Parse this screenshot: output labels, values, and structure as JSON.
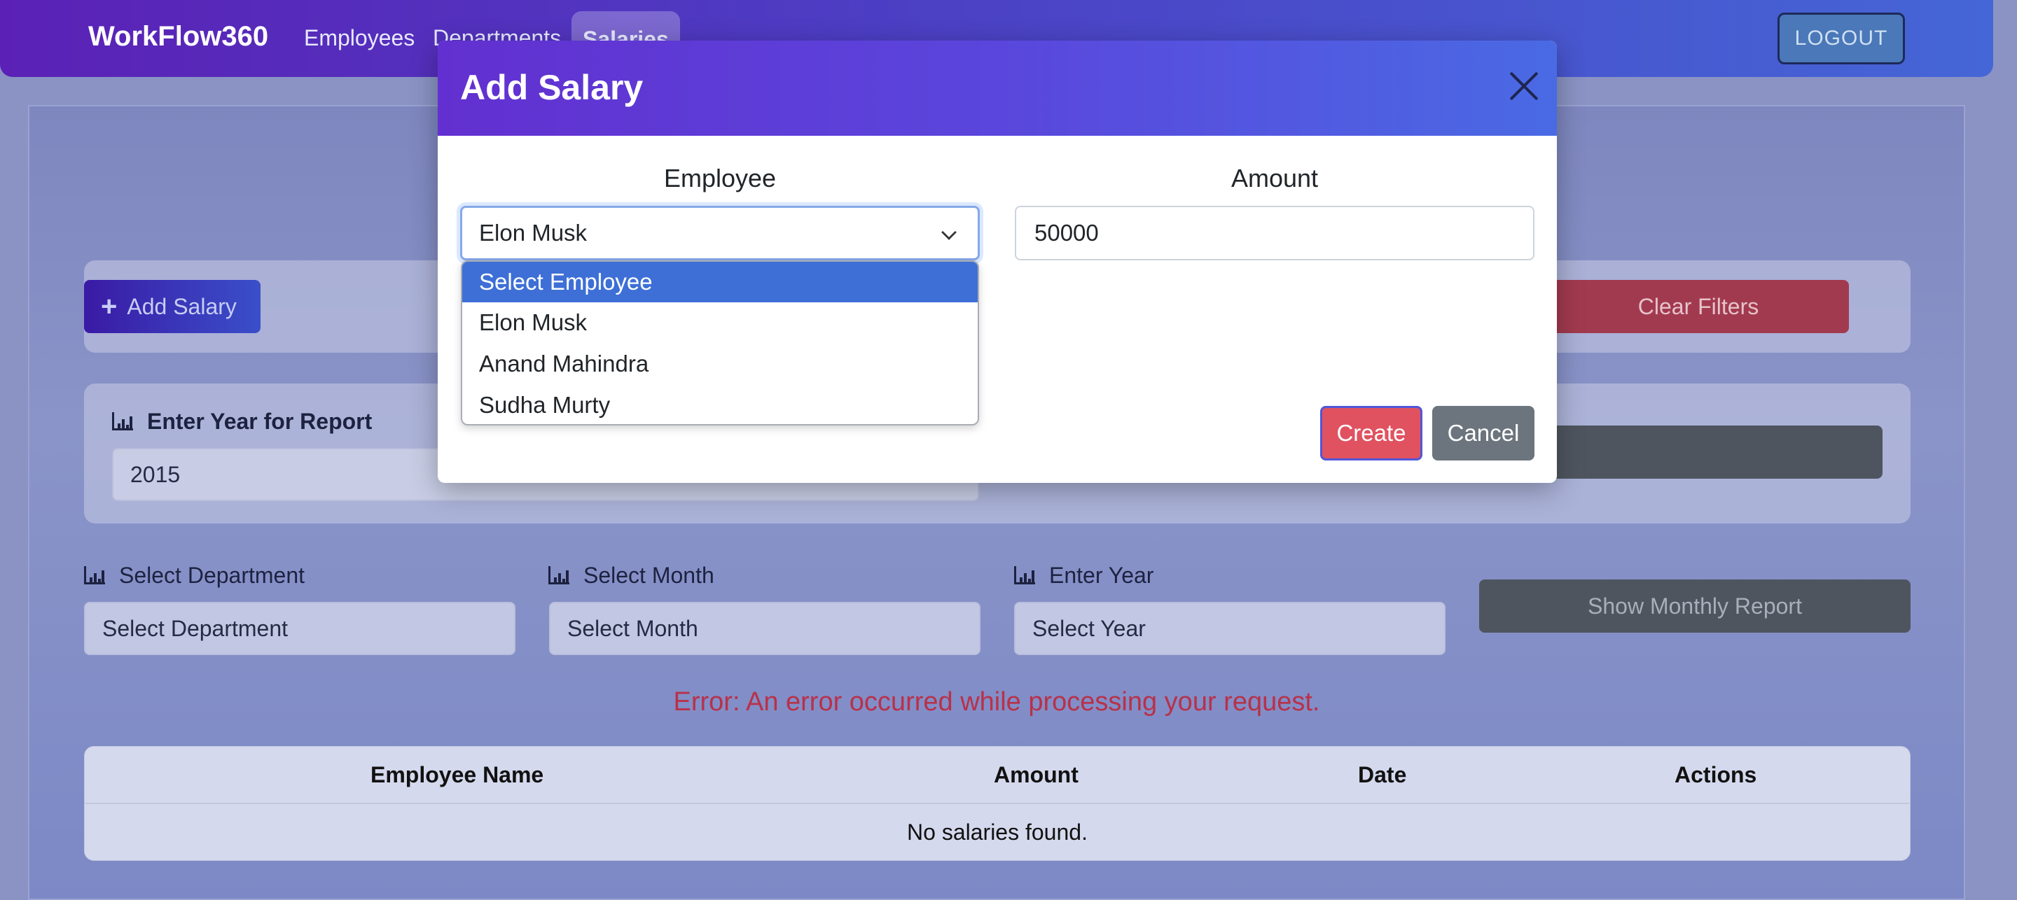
{
  "navbar": {
    "brand": "WorkFlow360",
    "links": [
      "Employees",
      "Departments",
      "Salaries"
    ],
    "active": "Salaries",
    "logout_label": "LOGOUT"
  },
  "toolbar": {
    "add_salary_label": "Add Salary",
    "clear_filters_label": "Clear Filters"
  },
  "report": {
    "year_label": "Enter Year for Report",
    "year_value": "2015"
  },
  "filters": {
    "department_label": "Select Department",
    "department_value": "Select Department",
    "month_label": "Select Month",
    "month_value": "Select Month",
    "year_label": "Enter Year",
    "year_placeholder": "Select Year",
    "monthly_report_label": "Show Monthly Report"
  },
  "error": "Error: An error occurred while processing your request.",
  "table": {
    "headers": [
      "Employee Name",
      "Amount",
      "Date",
      "Actions"
    ],
    "empty": "No salaries found."
  },
  "modal": {
    "title": "Add Salary",
    "employee_label": "Employee",
    "employee_value": "Elon Musk",
    "amount_label": "Amount",
    "amount_value": "50000",
    "create_label": "Create",
    "cancel_label": "Cancel",
    "employee_options": [
      "Select Employee",
      "Elon Musk",
      "Anand Mahindra",
      "Sudha Murty"
    ],
    "highlighted_option": "Select Employee"
  },
  "colors": {
    "accent": "#5a46dc",
    "danger": "#e05260",
    "secondary": "#6c757d",
    "error": "#b8314a"
  }
}
